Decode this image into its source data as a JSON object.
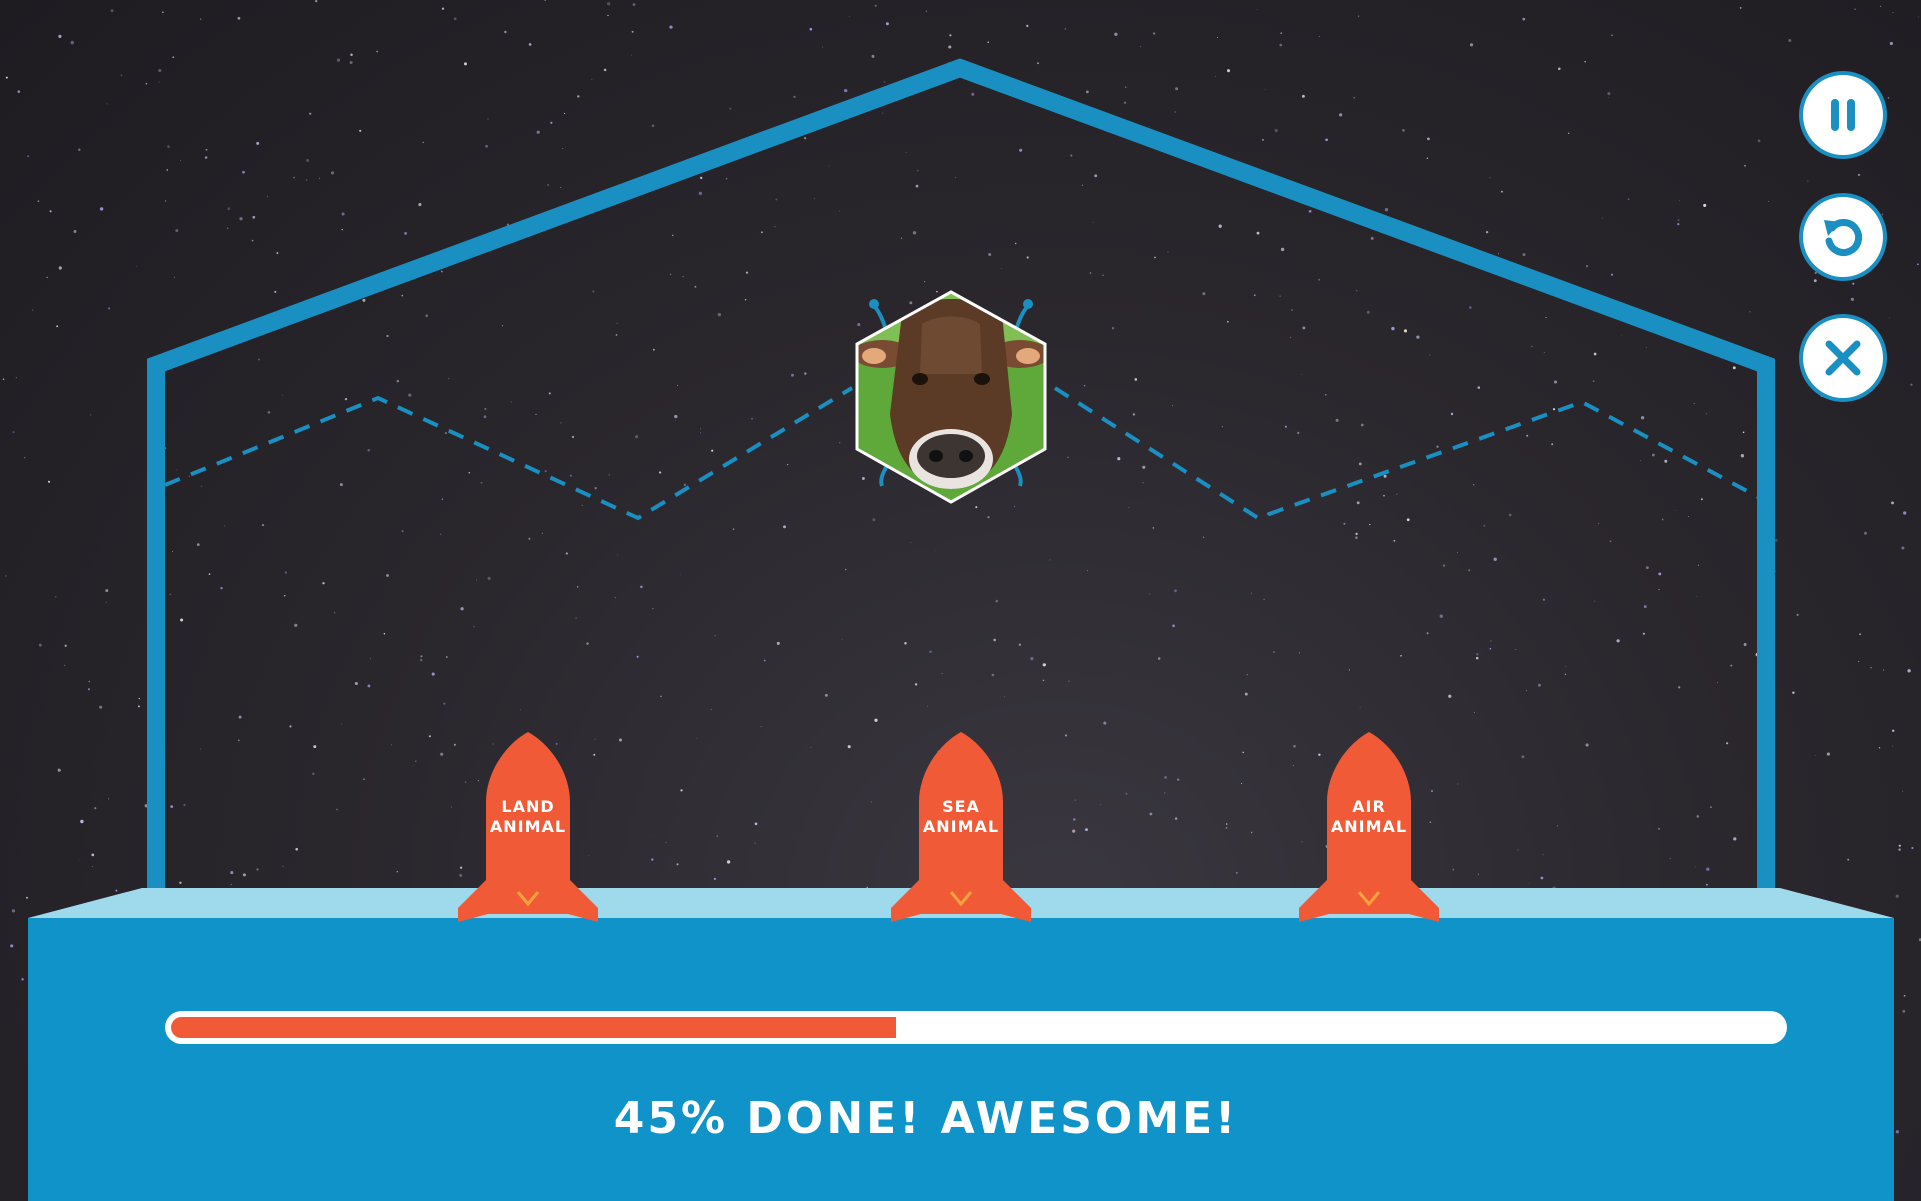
{
  "game": {
    "categories": [
      {
        "id": "land",
        "line1": "LAND",
        "line2": "ANIMAL"
      },
      {
        "id": "sea",
        "line1": "SEA",
        "line2": "ANIMAL"
      },
      {
        "id": "air",
        "line1": "AIR",
        "line2": "ANIMAL"
      }
    ],
    "current_item": {
      "animal": "cow",
      "image_icon": "cow-photo"
    },
    "progress": {
      "percent": 45
    },
    "status_text": "45% DONE! AWESOME!"
  },
  "controls": {
    "pause_icon": "pause-icon",
    "restart_icon": "restart-icon",
    "close_icon": "close-icon"
  },
  "colors": {
    "frame_blue": "#1a8fc2",
    "platform_top": "#9ed9ec",
    "platform_body": "#0f93c9",
    "rocket": "#f15a37",
    "progress_fill": "#f15a37",
    "progress_track": "#ffffff"
  }
}
